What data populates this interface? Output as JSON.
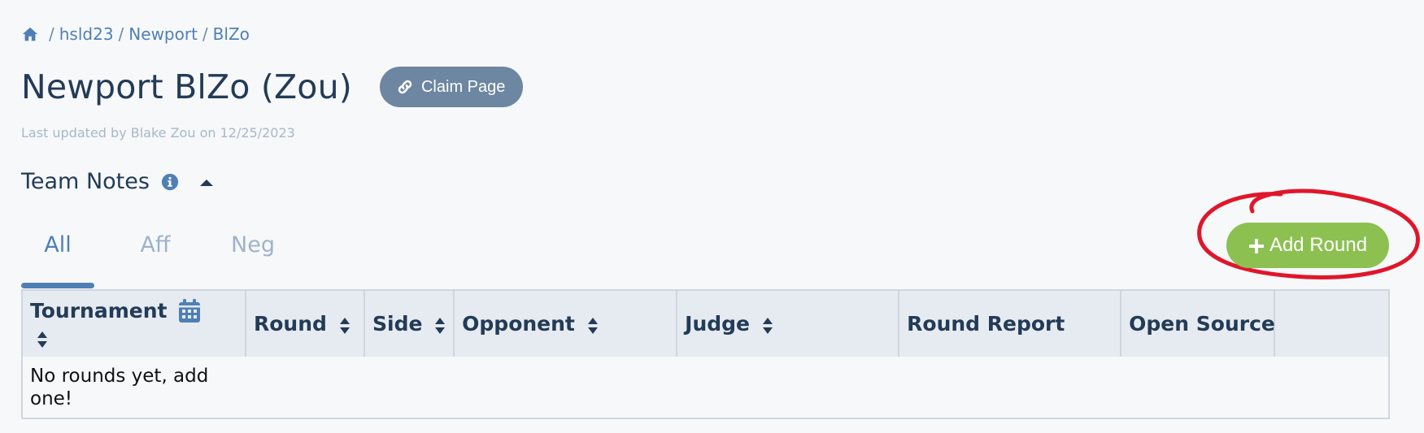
{
  "breadcrumb": {
    "items": [
      "hsld23",
      "Newport",
      "BlZo"
    ],
    "separator": "/"
  },
  "page": {
    "title": "Newport BlZo (Zou)",
    "claim_label": "Claim Page",
    "last_updated": "Last updated by Blake Zou on 12/25/2023"
  },
  "team_notes": {
    "label": "Team Notes"
  },
  "tabs": [
    {
      "label": "All",
      "active": true
    },
    {
      "label": "Aff",
      "active": false
    },
    {
      "label": "Neg",
      "active": false
    }
  ],
  "add_round": {
    "label": "Add Round"
  },
  "table": {
    "columns": [
      "Tournament",
      "Round",
      "Side",
      "Opponent",
      "Judge",
      "Round Report",
      "Open Source",
      ""
    ],
    "empty_message": "No rounds yet, add one!"
  },
  "colors": {
    "link": "#4f80b5",
    "title": "#233b57",
    "claim_button": "#6d86a1",
    "add_round_button": "#8cc152",
    "annotation": "#e0162b",
    "header_bg": "#e6ebf1"
  },
  "icons": {
    "home": "home-icon",
    "claim": "link-icon",
    "info": "info-icon",
    "collapse": "caret-up-icon",
    "add": "plus-icon",
    "calendar": "calendar-icon",
    "sort": "sort-icon"
  }
}
